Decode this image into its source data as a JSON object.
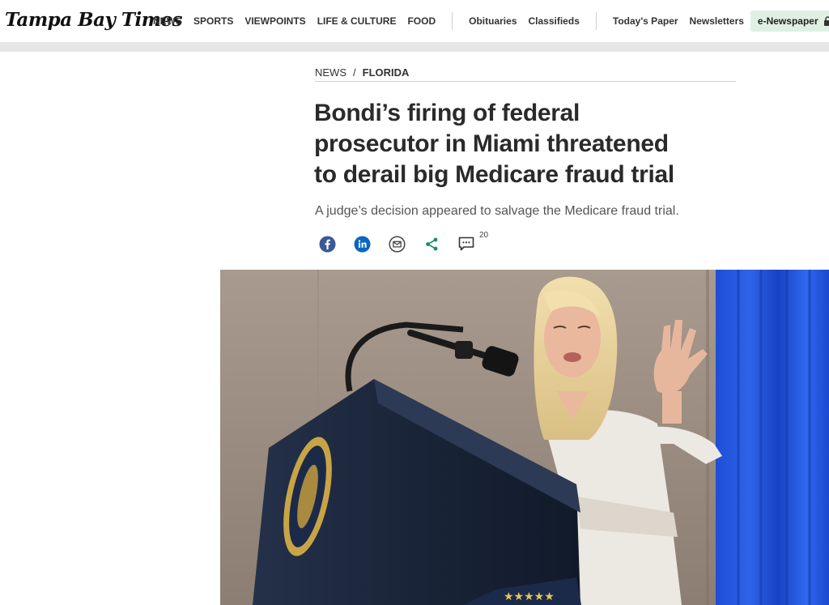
{
  "site": {
    "logo_text": "Tampa Bay Times"
  },
  "nav": {
    "primary": [
      "NEWS",
      "SPORTS",
      "VIEWPOINTS",
      "LIFE & CULTURE",
      "FOOD"
    ],
    "secondary": [
      "Obituaries",
      "Classifieds"
    ],
    "tertiary": [
      "Today's Paper",
      "Newsletters"
    ],
    "enewspaper_label": "e-Newspaper"
  },
  "breadcrumb": {
    "section": "NEWS",
    "separator": "/",
    "subsection": "FLORIDA"
  },
  "article": {
    "headline": "Bondi’s firing of federal prosecutor in Miami threatened to derail big Medicare fraud trial",
    "dek": "A judge’s decision appeared to salvage the Medicare fraud trial.",
    "comment_count": "20"
  },
  "share_icons": [
    "facebook-icon",
    "linkedin-icon",
    "email-icon",
    "share-icon",
    "comment-icon"
  ],
  "colors": {
    "facebook": "#3b5998",
    "linkedin": "#0a66c2",
    "enewspaper_bg": "#dff0e3",
    "share_green": "#1f8a70"
  }
}
